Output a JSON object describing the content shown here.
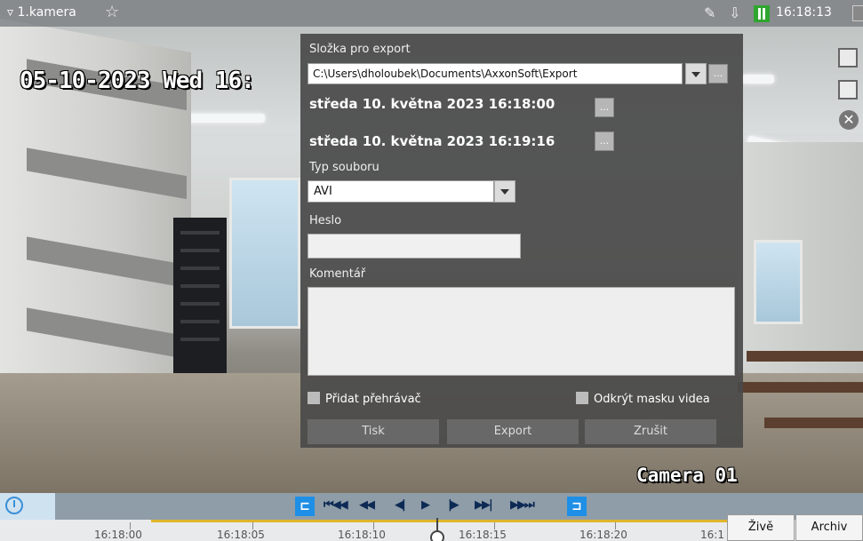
{
  "topbar": {
    "camera_name": "1.kamera",
    "star_icon": "☆",
    "time": "16:18:13"
  },
  "osd": {
    "datetime": "05-10-2023 Wed 16:",
    "camera_label": "Camera 01"
  },
  "dialog": {
    "folder_label": "Složka pro export",
    "folder_path": "C:\\Users\\dholoubek\\Documents\\AxxonSoft\\Export",
    "browse_label": "...",
    "start_date": "středa 10. května 2023 16:18:00",
    "end_date": "středa 10. května 2023 16:19:16",
    "file_type_label": "Typ souboru",
    "file_type_value": "AVI",
    "password_label": "Heslo",
    "password_value": "",
    "comment_label": "Komentář",
    "comment_value": "",
    "add_player_label": "Přidat přehrávač",
    "unmask_label": "Odkrýt masku videa",
    "print_button": "Tisk",
    "export_button": "Export",
    "cancel_button": "Zrušit"
  },
  "playback": {
    "controls": [
      "⏮◀◀",
      "◀◀",
      "◀|",
      "▶",
      "|▶",
      "▶▶|",
      "▶▶⏭"
    ]
  },
  "timeline": {
    "labels": [
      "16:18:00",
      "16:18:05",
      "16:18:10",
      "16:18:15",
      "16:18:20",
      "16:1"
    ]
  },
  "modes": {
    "live": "Živě",
    "archive": "Archiv"
  },
  "colors": {
    "accent_blue": "#1e8fe6",
    "pause_green": "#2fa62f",
    "dialog_bg": "#4a4a4a",
    "timeline_range": "#e0b42a"
  }
}
